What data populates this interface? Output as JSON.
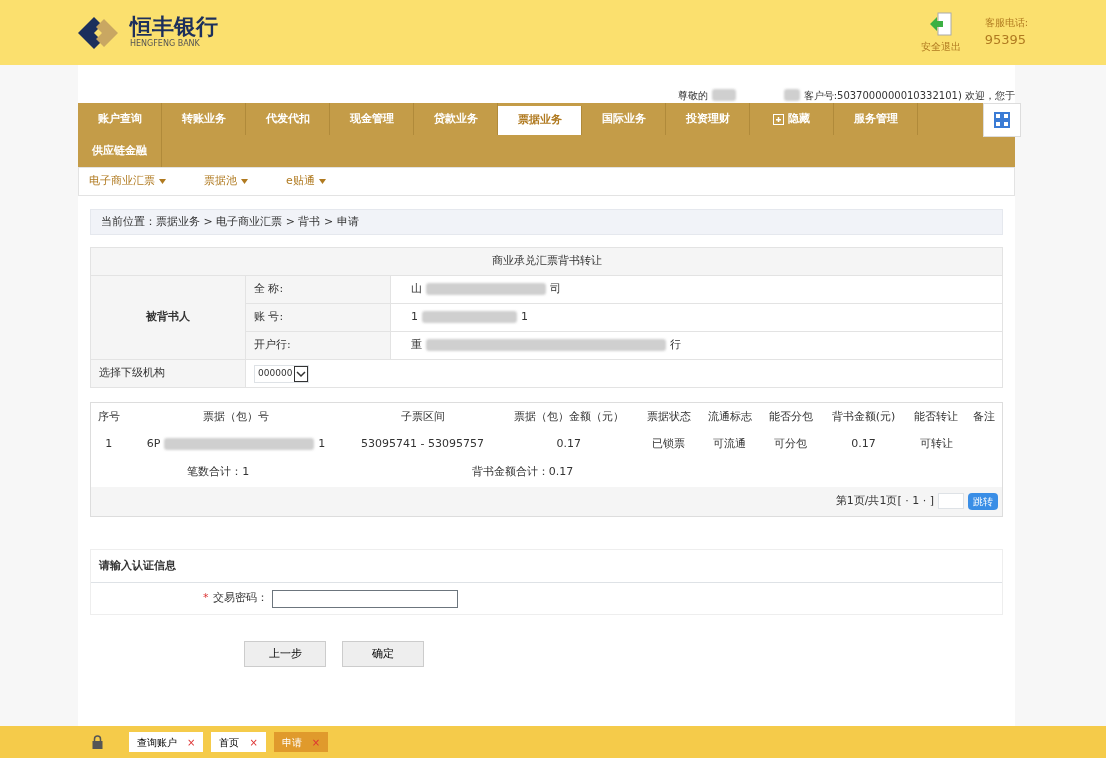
{
  "header": {
    "bank_name": "恒丰银行",
    "bank_name_en": "HENGFENG BANK",
    "logout": "安全退出",
    "hotline_label": "客服电话:",
    "hotline": "95395"
  },
  "welcome": {
    "greeting": "尊敬的",
    "customer": "客户号:5037000000010332101) 欢迎，您于"
  },
  "main_tabs": [
    {
      "label": "账户查询",
      "selected": false
    },
    {
      "label": "转账业务",
      "selected": false
    },
    {
      "label": "代发代扣",
      "selected": false
    },
    {
      "label": "现金管理",
      "selected": false
    },
    {
      "label": "贷款业务",
      "selected": false
    },
    {
      "label": "票据业务",
      "selected": true
    },
    {
      "label": "国际业务",
      "selected": false
    },
    {
      "label": "投资理财",
      "selected": false
    },
    {
      "label": "隐藏",
      "selected": false,
      "kind": "toggle"
    },
    {
      "label": "服务管理",
      "selected": false
    },
    {
      "label": "供应链金融",
      "selected": false
    }
  ],
  "sub_menu": [
    "电子商业汇票",
    "票据池",
    "e贴通"
  ],
  "breadcrumb": "当前位置：票据业务 > 电子商业汇票 > 背书 > 申请",
  "form": {
    "title": "商业承兑汇票背书转让",
    "party_label": "被背书人",
    "fields": [
      {
        "label": "全 称:",
        "value_start": "山",
        "value_end": "司"
      },
      {
        "label": "账 号:",
        "value_start": "1",
        "value_end": "1"
      },
      {
        "label": "开户行:",
        "value_start": "重",
        "value_end": "行"
      }
    ],
    "branch_label": "选择下级机构",
    "branch_value": "000000"
  },
  "table": {
    "columns": [
      "序号",
      "票据（包）号",
      "子票区间",
      "票据（包）金额（元）",
      "票据状态",
      "流通标志",
      "能否分包",
      "背书金额(元)",
      "能否转让",
      "备注"
    ],
    "rows": [
      {
        "cells": [
          "1",
          "6P",
          "53095741 - 53095757",
          "0.17",
          "已锁票",
          "可流通",
          "可分包",
          "0.17",
          "可转让",
          ""
        ],
        "redacted_id_end": "1"
      }
    ],
    "count_total": "笔数合计：1",
    "amount_total": "背书金额合计：0.17",
    "pager": "第1页/共1页[ · 1 · ]",
    "jump": "跳转"
  },
  "auth": {
    "title": "请输入认证信息",
    "required_mark": "*",
    "password_label": "交易密码："
  },
  "buttons": [
    "上一步",
    "确定"
  ],
  "bottom_tabs": [
    {
      "label": "查询账户",
      "selected": false
    },
    {
      "label": "首页",
      "selected": false
    },
    {
      "label": "申请",
      "selected": true
    }
  ],
  "close_mark": "×"
}
